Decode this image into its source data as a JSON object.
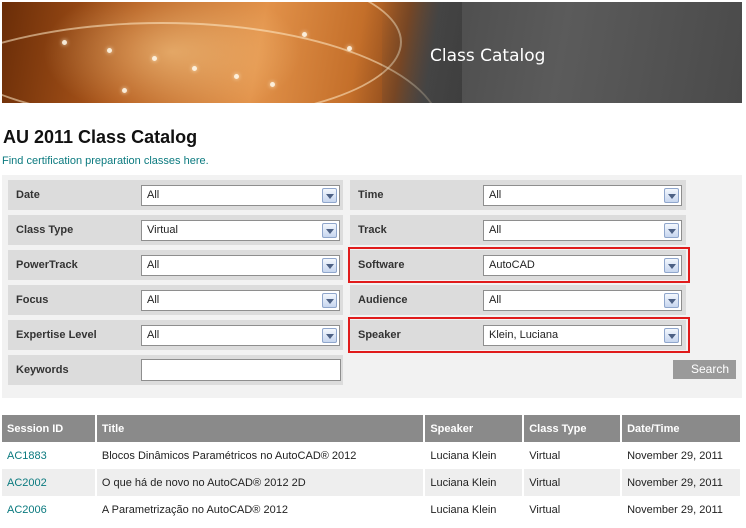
{
  "banner": {
    "title": "Class Catalog"
  },
  "page": {
    "title": "AU 2011 Class Catalog",
    "cert_link": "Find certification preparation classes here."
  },
  "filters": {
    "date": {
      "label": "Date",
      "value": "All"
    },
    "time": {
      "label": "Time",
      "value": "All"
    },
    "class_type": {
      "label": "Class Type",
      "value": "Virtual"
    },
    "track": {
      "label": "Track",
      "value": "All"
    },
    "powertrack": {
      "label": "PowerTrack",
      "value": "All"
    },
    "software": {
      "label": "Software",
      "value": "AutoCAD"
    },
    "focus": {
      "label": "Focus",
      "value": "All"
    },
    "audience": {
      "label": "Audience",
      "value": "All"
    },
    "expertise": {
      "label": "Expertise Level",
      "value": "All"
    },
    "speaker": {
      "label": "Speaker",
      "value": "Klein, Luciana"
    },
    "keywords": {
      "label": "Keywords",
      "value": ""
    },
    "search_label": "Search",
    "highlight_color": "#e01b1b"
  },
  "results": {
    "columns": [
      "Session ID",
      "Title",
      "Speaker",
      "Class Type",
      "Date/Time"
    ],
    "rows": [
      [
        "AC1883",
        "Blocos Dinâmicos Paramétricos no AutoCAD® 2012",
        "Luciana Klein",
        "Virtual",
        "November 29, 2011"
      ],
      [
        "AC2002",
        "O que há de novo no AutoCAD® 2012 2D",
        "Luciana Klein",
        "Virtual",
        "November 29, 2011"
      ],
      [
        "AC2006",
        "A Parametrização no AutoCAD® 2012",
        "Luciana Klein",
        "Virtual",
        "November 29, 2011"
      ]
    ]
  },
  "colors": {
    "link": "#0b7a7f",
    "header_bg": "#8a8a8a",
    "panel_bg": "#f2f2f2",
    "row_bg": "#dcdcdc"
  }
}
